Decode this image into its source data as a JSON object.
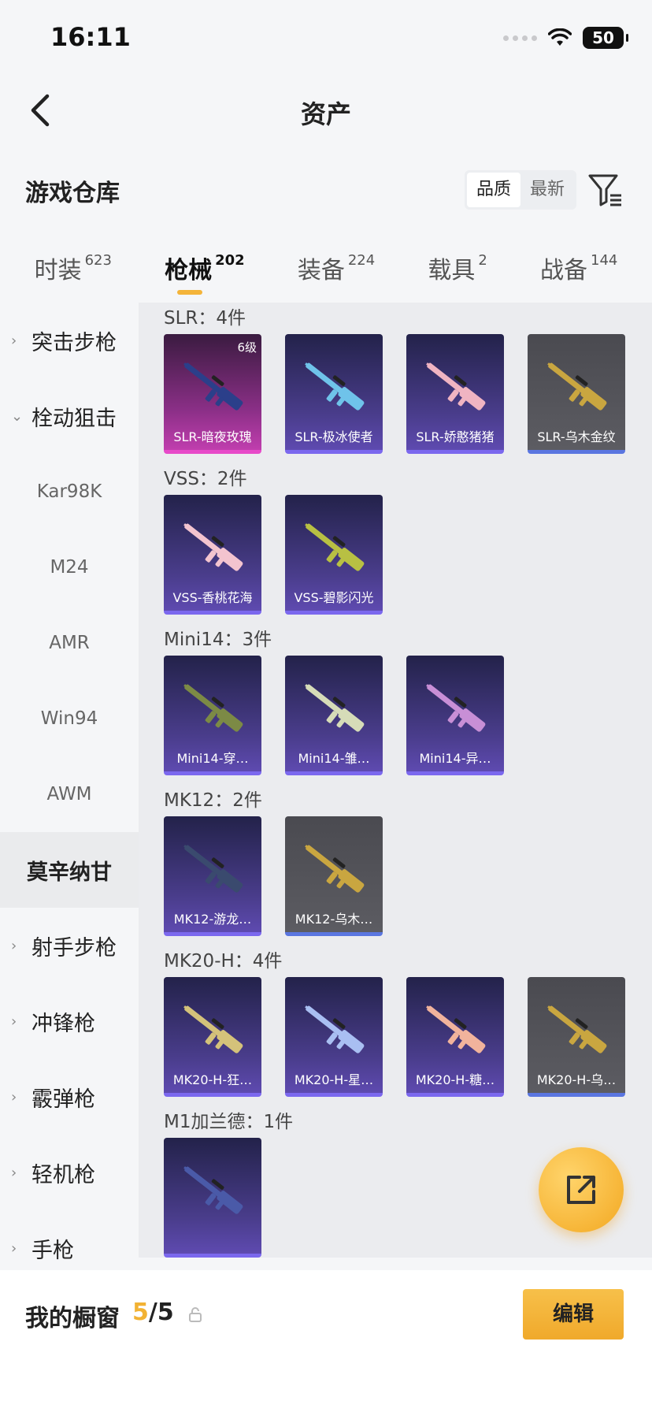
{
  "status": {
    "time": "16:11",
    "battery": "50"
  },
  "nav": {
    "title": "资产"
  },
  "section": {
    "title": "游戏仓库",
    "sort_quality": "品质",
    "sort_newest": "最新"
  },
  "tabs": [
    {
      "label": "时装",
      "count": "623"
    },
    {
      "label": "枪械",
      "count": "202"
    },
    {
      "label": "装备",
      "count": "224"
    },
    {
      "label": "载具",
      "count": "2"
    },
    {
      "label": "战备",
      "count": "144"
    }
  ],
  "sidebar": [
    {
      "label": "突击步枪",
      "type": "parent",
      "arrow": "›"
    },
    {
      "label": "栓动狙击",
      "type": "parent",
      "arrow": "⌄"
    },
    {
      "label": "Kar98K",
      "type": "child"
    },
    {
      "label": "M24",
      "type": "child"
    },
    {
      "label": "AMR",
      "type": "child"
    },
    {
      "label": "Win94",
      "type": "child"
    },
    {
      "label": "AWM",
      "type": "child"
    },
    {
      "label": "莫辛纳甘",
      "type": "selected"
    },
    {
      "label": "射手步枪",
      "type": "parent",
      "arrow": "›"
    },
    {
      "label": "冲锋枪",
      "type": "parent",
      "arrow": "›"
    },
    {
      "label": "霰弹枪",
      "type": "parent",
      "arrow": "›"
    },
    {
      "label": "轻机枪",
      "type": "parent",
      "arrow": "›"
    },
    {
      "label": "手枪",
      "type": "parent",
      "arrow": "›"
    }
  ],
  "groups": [
    {
      "title": "SLR：4件",
      "items": [
        {
          "name": "SLR-暗夜玫瑰",
          "rarity": "pink",
          "level": "6级",
          "color": "#2b3f8a"
        },
        {
          "name": "SLR-极冰使者",
          "rarity": "purple",
          "color": "#6fc3ea"
        },
        {
          "name": "SLR-娇憨猪猪",
          "rarity": "purple",
          "color": "#f0b4c2"
        },
        {
          "name": "SLR-乌木金纹",
          "rarity": "gray",
          "color": "#c9a640"
        }
      ]
    },
    {
      "title": "VSS：2件",
      "items": [
        {
          "name": "VSS-香桃花海",
          "rarity": "purple",
          "color": "#f3c4cf"
        },
        {
          "name": "VSS-碧影闪光",
          "rarity": "purple",
          "color": "#b8c043"
        }
      ]
    },
    {
      "title": "Mini14：3件",
      "items": [
        {
          "name": "Mini14-穿…",
          "rarity": "purple",
          "color": "#7c8a45"
        },
        {
          "name": "Mini14-雏…",
          "rarity": "purple",
          "color": "#d6dcb8"
        },
        {
          "name": "Mini14-异…",
          "rarity": "purple",
          "color": "#c88fd6"
        }
      ]
    },
    {
      "title": "MK12：2件",
      "items": [
        {
          "name": "MK12-游龙…",
          "rarity": "purple",
          "color": "#3a4a6e"
        },
        {
          "name": "MK12-乌木…",
          "rarity": "gray",
          "color": "#c9a640"
        }
      ]
    },
    {
      "title": "MK20-H：4件",
      "items": [
        {
          "name": "MK20-H-狂…",
          "rarity": "purple",
          "color": "#d4c27a"
        },
        {
          "name": "MK20-H-星…",
          "rarity": "purple",
          "color": "#a9bff2"
        },
        {
          "name": "MK20-H-糖…",
          "rarity": "purple",
          "color": "#f1b39c"
        },
        {
          "name": "MK20-H-乌…",
          "rarity": "gray",
          "color": "#c9a640"
        }
      ]
    },
    {
      "title": "M1加兰德：1件",
      "items": [
        {
          "name": "",
          "rarity": "purple",
          "color": "#4a5aa8"
        }
      ]
    }
  ],
  "bottom": {
    "label": "我的橱窗",
    "count_current": "5",
    "count_sep": "/",
    "count_max": "5",
    "edit_label": "编辑"
  },
  "colors": {
    "accent": "#f2b233",
    "selected_bg": "#eaebed"
  }
}
